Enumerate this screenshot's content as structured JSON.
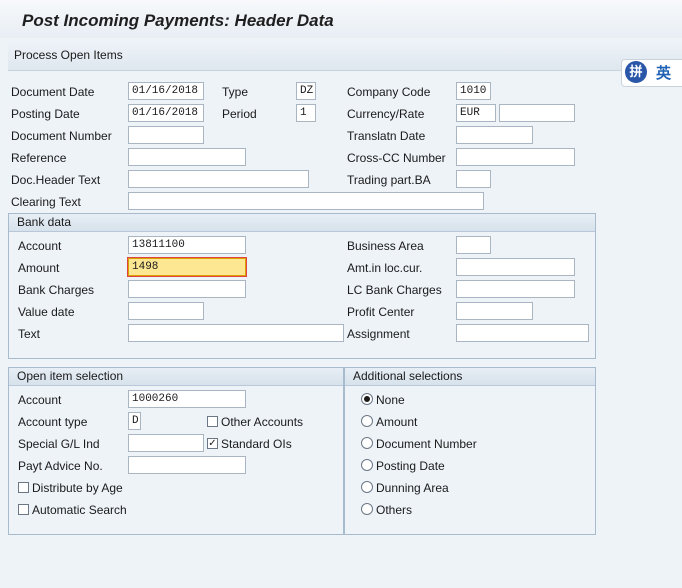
{
  "window": {
    "title": "Post Incoming Payments: Header Data"
  },
  "toolbar": {
    "process_open_items": "Process Open Items"
  },
  "ime": {
    "logo_text": "拼",
    "lang_text": "英"
  },
  "header": {
    "document_date": {
      "label": "Document Date",
      "value": "01/16/2018"
    },
    "type": {
      "label": "Type",
      "value": "DZ"
    },
    "company_code": {
      "label": "Company Code",
      "value": "1010"
    },
    "posting_date": {
      "label": "Posting Date",
      "value": "01/16/2018"
    },
    "period": {
      "label": "Period",
      "value": "1"
    },
    "currency_rate": {
      "label": "Currency/Rate",
      "value": "EUR",
      "rate": ""
    },
    "document_number": {
      "label": "Document Number",
      "value": ""
    },
    "translatn_date": {
      "label": "Translatn Date",
      "value": ""
    },
    "reference": {
      "label": "Reference",
      "value": ""
    },
    "cross_cc_number": {
      "label": "Cross-CC Number",
      "value": ""
    },
    "doc_header_text": {
      "label": "Doc.Header Text",
      "value": ""
    },
    "trading_part_ba": {
      "label": "Trading part.BA",
      "value": ""
    },
    "clearing_text": {
      "label": "Clearing Text",
      "value": ""
    }
  },
  "bank_data": {
    "title": "Bank data",
    "account": {
      "label": "Account",
      "value": "13811100"
    },
    "amount": {
      "label": "Amount",
      "value": "1498"
    },
    "bank_charges": {
      "label": "Bank Charges",
      "value": ""
    },
    "value_date": {
      "label": "Value date",
      "value": ""
    },
    "text": {
      "label": "Text",
      "value": ""
    },
    "business_area": {
      "label": "Business Area",
      "value": ""
    },
    "amt_loc_cur": {
      "label": "Amt.in loc.cur.",
      "value": ""
    },
    "lc_bank_charges": {
      "label": "LC Bank Charges",
      "value": ""
    },
    "profit_center": {
      "label": "Profit Center",
      "value": ""
    },
    "assignment": {
      "label": "Assignment",
      "value": ""
    }
  },
  "open_item_selection": {
    "title": "Open item selection",
    "account": {
      "label": "Account",
      "value": "1000260"
    },
    "account_type": {
      "label": "Account type",
      "value": "D"
    },
    "other_accounts": {
      "label": "Other Accounts",
      "checked": false
    },
    "special_gl_ind": {
      "label": "Special G/L Ind",
      "value": ""
    },
    "standard_ois": {
      "label": "Standard OIs",
      "checked": true,
      "mark": "✓"
    },
    "payt_advice_no": {
      "label": "Payt Advice No.",
      "value": ""
    },
    "distribute_by_age": {
      "label": "Distribute by Age",
      "checked": false
    },
    "automatic_search": {
      "label": "Automatic Search",
      "checked": false
    }
  },
  "additional_selections": {
    "title": "Additional selections",
    "options": [
      {
        "label": "None",
        "selected": true
      },
      {
        "label": "Amount",
        "selected": false
      },
      {
        "label": "Document Number",
        "selected": false
      },
      {
        "label": "Posting Date",
        "selected": false
      },
      {
        "label": "Dunning Area",
        "selected": false
      },
      {
        "label": "Others",
        "selected": false
      }
    ]
  }
}
